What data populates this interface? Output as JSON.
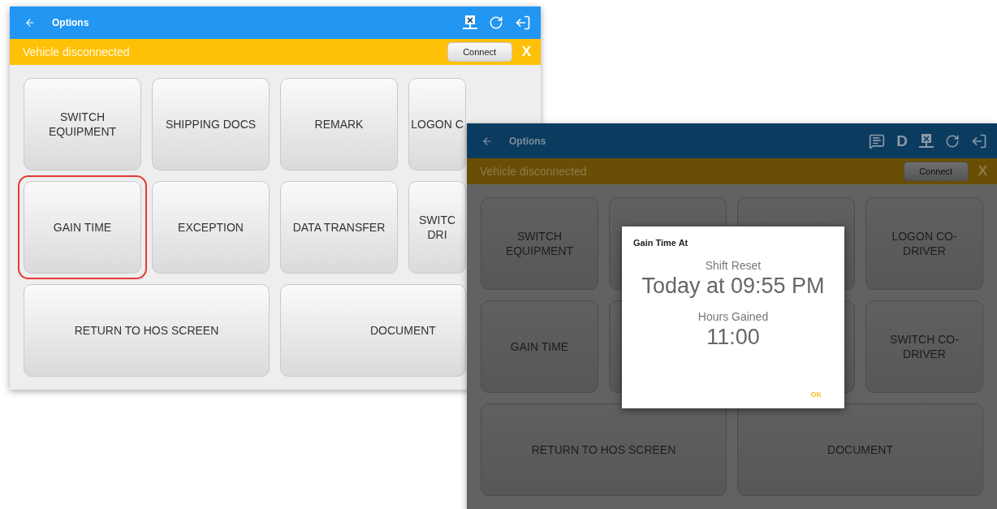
{
  "screens": [
    {
      "dimmed": false,
      "title": "Options",
      "header_actions": [
        {
          "kind": "disconnected"
        },
        {
          "kind": "refresh"
        },
        {
          "kind": "logout"
        }
      ],
      "banner": {
        "text": "Vehicle disconnected",
        "button": "Connect",
        "close": "X"
      },
      "buttons": [
        {
          "kind": "normal",
          "label": "SWITCH EQUIPMENT",
          "highlighted": false
        },
        {
          "kind": "normal",
          "label": "SHIPPING DOCS",
          "highlighted": false
        },
        {
          "kind": "normal",
          "label": "REMARK",
          "highlighted": false
        },
        {
          "kind": "partial",
          "label": "LOGON C",
          "highlighted": false
        },
        {
          "kind": "normal",
          "label": "GAIN TIME",
          "highlighted": true
        },
        {
          "kind": "normal",
          "label": "EXCEPTION",
          "highlighted": false
        },
        {
          "kind": "normal",
          "label": "DATA TRANSFER",
          "highlighted": false
        },
        {
          "kind": "partial",
          "label": "SWITC\nDRI",
          "highlighted": false
        },
        {
          "kind": "wide",
          "label": "RETURN TO HOS SCREEN",
          "highlighted": false
        },
        {
          "kind": "wide-partial",
          "label": "DOCUMENT",
          "highlighted": false
        }
      ]
    },
    {
      "dimmed": true,
      "title": "Options",
      "header_actions": [
        {
          "kind": "messages"
        },
        {
          "kind": "text",
          "label": "D"
        },
        {
          "kind": "disconnected"
        },
        {
          "kind": "refresh"
        },
        {
          "kind": "logout"
        }
      ],
      "banner": {
        "text": "Vehicle disconnected",
        "button": "Connect",
        "close": "X"
      },
      "buttons": [
        {
          "kind": "normal",
          "label": "SWITCH EQUIPMENT",
          "highlighted": false
        },
        {
          "kind": "normal",
          "highlighted": false
        },
        {
          "kind": "normal",
          "highlighted": false
        },
        {
          "kind": "normal",
          "label": "LOGON CO-DRIVER",
          "highlighted": false
        },
        {
          "kind": "normal",
          "label": "GAIN TIME",
          "highlighted": false
        },
        {
          "kind": "normal",
          "highlighted": false
        },
        {
          "kind": "normal",
          "highlighted": false
        },
        {
          "kind": "normal",
          "label": "SWITCH CO-DRIVER",
          "highlighted": false
        },
        {
          "kind": "wide",
          "label": "RETURN TO HOS SCREEN",
          "highlighted": false
        },
        {
          "kind": "wide",
          "label": "DOCUMENT",
          "highlighted": false
        }
      ],
      "dialog": {
        "title": "Gain Time At",
        "rows": [
          {
            "label": "Shift Reset",
            "value": "Today at 09:55 PM"
          },
          {
            "label": "Hours Gained",
            "value": "11:00"
          }
        ],
        "ok": "OK"
      }
    }
  ]
}
